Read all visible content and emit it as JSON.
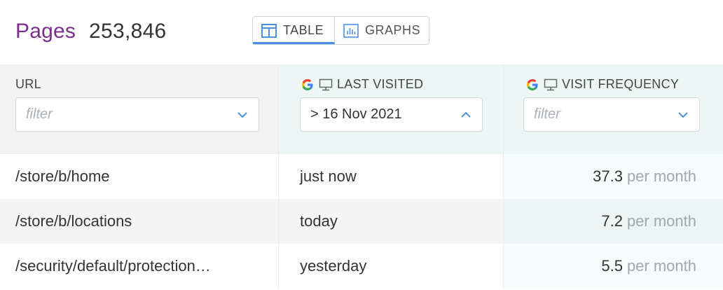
{
  "header": {
    "title": "Pages",
    "count": "253,846"
  },
  "view_toggle": {
    "table_label": "TABLE",
    "graphs_label": "GRAPHS",
    "active": "TABLE"
  },
  "columns": [
    {
      "label": "URL",
      "filter_placeholder": "filter",
      "filter_value": "",
      "chevron": "chevron-down-icon"
    },
    {
      "label": "LAST VISITED",
      "filter_placeholder": "",
      "filter_value": "> 16 Nov 2021",
      "chevron": "chevron-up-icon"
    },
    {
      "label": "VISIT FREQUENCY",
      "filter_placeholder": "filter",
      "filter_value": "",
      "chevron": "chevron-down-icon"
    }
  ],
  "rows": [
    {
      "url": "/store/b/home",
      "last_visited": "just now",
      "frequency": "37.3",
      "unit": "per month"
    },
    {
      "url": "/store/b/locations",
      "last_visited": "today",
      "frequency": "7.2",
      "unit": "per month"
    },
    {
      "url": "/security/default/protection…",
      "last_visited": "yesterday",
      "frequency": "5.5",
      "unit": "per month"
    }
  ],
  "colors": {
    "title": "#7b2d8e",
    "accent": "#4a90e2",
    "header_bg": "#eef6f5"
  }
}
